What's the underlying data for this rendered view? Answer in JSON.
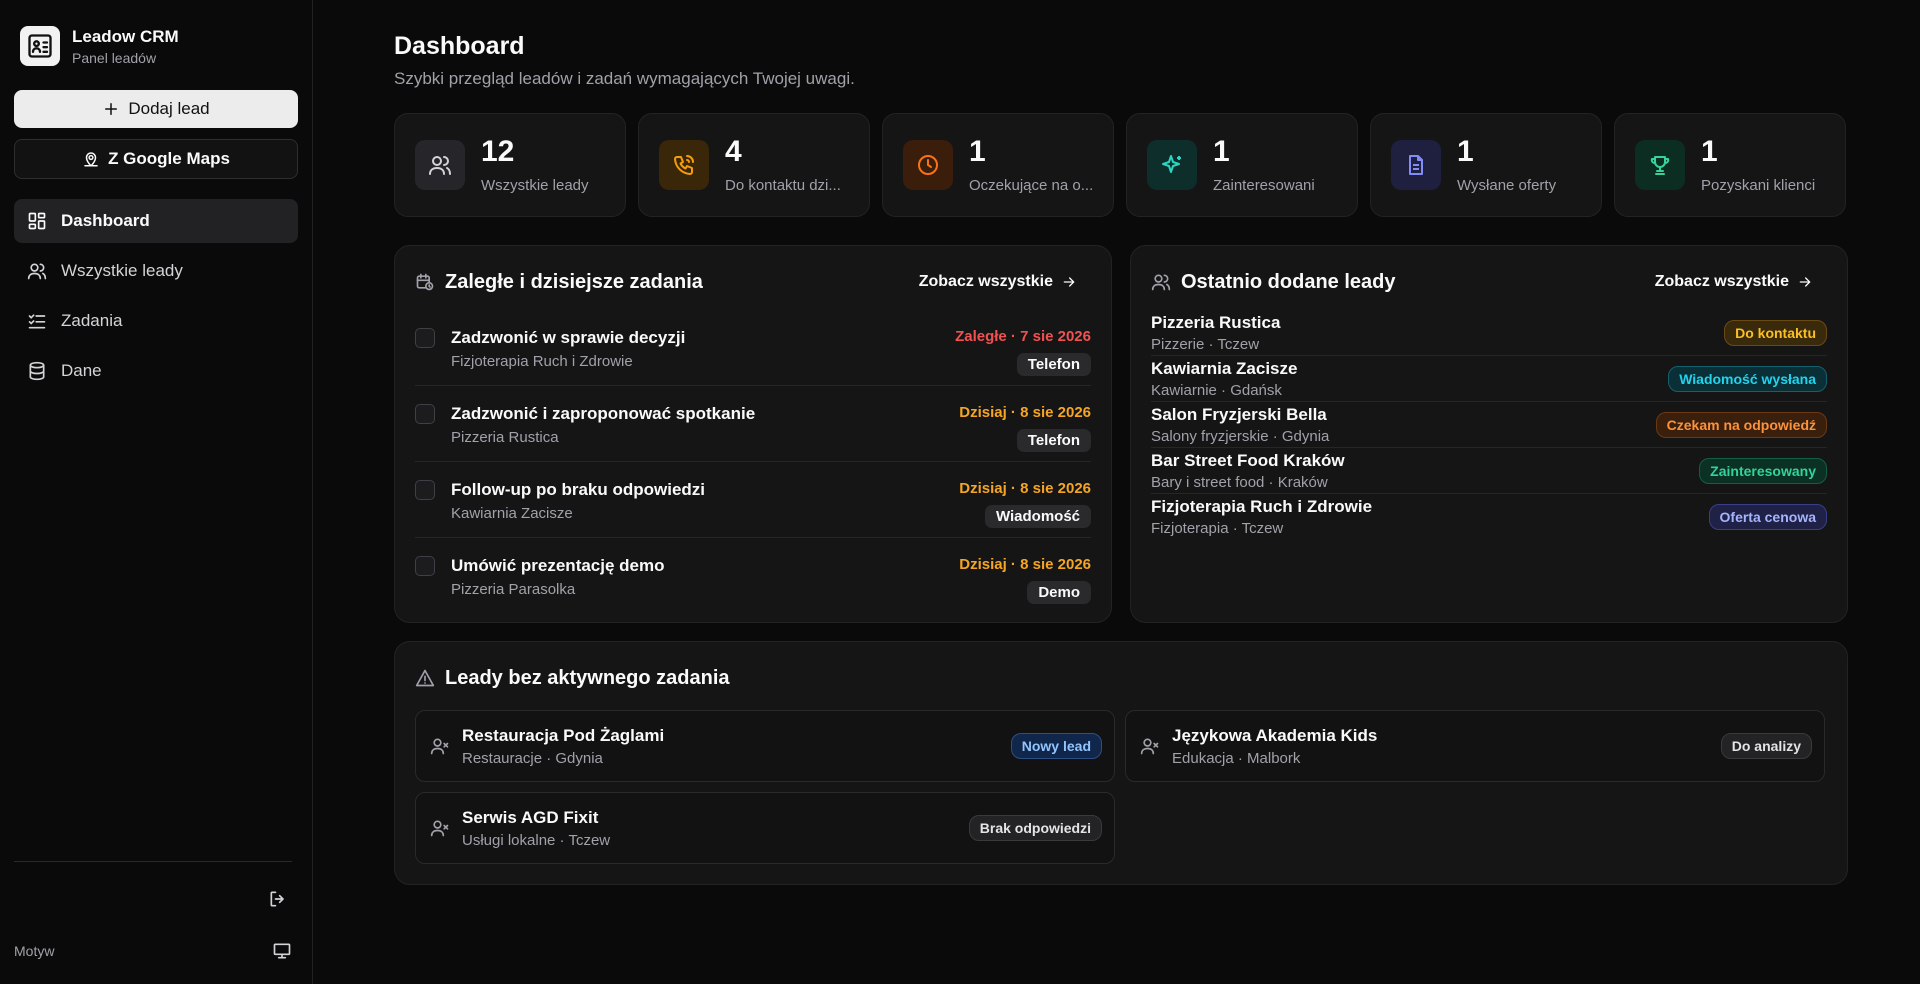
{
  "brand": {
    "title": "Leadow CRM",
    "subtitle": "Panel leadów"
  },
  "sidebar": {
    "add_lead_label": "Dodaj lead",
    "google_maps_label": "Z Google Maps",
    "items": [
      {
        "label": "Dashboard",
        "icon": "dashboard-icon",
        "active": true
      },
      {
        "label": "Wszystkie leady",
        "icon": "users-icon"
      },
      {
        "label": "Zadania",
        "icon": "checklist-icon"
      },
      {
        "label": "Dane",
        "icon": "database-icon"
      }
    ],
    "theme_label": "Motyw"
  },
  "header": {
    "title": "Dashboard",
    "subtitle": "Szybki przegląd leadów i zadań wymagających Twojej uwagi."
  },
  "stats": [
    {
      "value": "12",
      "label": "Wszystkie leady",
      "icon": "users-icon",
      "color": "#a1a1aa"
    },
    {
      "value": "4",
      "label": "Do kontaktu dzi...",
      "icon": "phone-icon",
      "color": "#f59e0b"
    },
    {
      "value": "1",
      "label": "Oczekujące na o...",
      "icon": "clock-icon",
      "color": "#f97316"
    },
    {
      "value": "1",
      "label": "Zainteresowani",
      "icon": "sparkles-icon",
      "color": "#2dd4bf"
    },
    {
      "value": "1",
      "label": "Wysłane oferty",
      "icon": "file-icon",
      "color": "#818cf8"
    },
    {
      "value": "1",
      "label": "Pozyskani klienci",
      "icon": "trophy-icon",
      "color": "#34d399"
    }
  ],
  "tasks": {
    "title": "Zaległe i dzisiejsze zadania",
    "see_all": "Zobacz wszystkie",
    "items": [
      {
        "title": "Zadzwonić w sprawie decyzji",
        "lead": "Fizjoterapia Ruch i Zdrowie",
        "due": "Zaległe · 7 sie 2026",
        "tag": "Telefon",
        "status": "over"
      },
      {
        "title": "Zadzwonić i zaproponować spotkanie",
        "lead": "Pizzeria Rustica",
        "due": "Dzisiaj · 8 sie 2026",
        "tag": "Telefon",
        "status": "today"
      },
      {
        "title": "Follow-up po braku odpowiedzi",
        "lead": "Kawiarnia Zacisze",
        "due": "Dzisiaj · 8 sie 2026",
        "tag": "Wiadomość",
        "status": "today"
      },
      {
        "title": "Umówić prezentację demo",
        "lead": "Pizzeria Parasolka",
        "due": "Dzisiaj · 8 sie 2026",
        "tag": "Demo",
        "status": "today"
      }
    ]
  },
  "recent": {
    "title": "Ostatnio dodane leady",
    "see_all": "Zobacz wszystkie",
    "items": [
      {
        "name": "Pizzeria Rustica",
        "sub": "Pizzerie · Tczew",
        "badge": "Do kontaktu",
        "color": "orange"
      },
      {
        "name": "Kawiarnia Zacisze",
        "sub": "Kawiarnie · Gdańsk",
        "badge": "Wiadomość wysłana",
        "color": "cyan"
      },
      {
        "name": "Salon Fryzjerski Bella",
        "sub": "Salony fryzjerskie · Gdynia",
        "badge": "Czekam na odpowiedź",
        "color": "amber"
      },
      {
        "name": "Bar Street Food Kraków",
        "sub": "Bary i street food · Kraków",
        "badge": "Zainteresowany",
        "color": "green"
      },
      {
        "name": "Fizjoterapia Ruch i Zdrowie",
        "sub": "Fizjoterapia · Tczew",
        "badge": "Oferta cenowa",
        "color": "indigo"
      }
    ]
  },
  "no_active": {
    "title": "Leady bez aktywnego zadania",
    "items": [
      {
        "name": "Restauracja Pod Żaglami",
        "sub": "Restauracje · Gdynia",
        "badge": "Nowy lead",
        "color": "blue"
      },
      {
        "name": "Językowa Akademia Kids",
        "sub": "Edukacja · Malbork",
        "badge": "Do analizy",
        "color": "gray"
      },
      {
        "name": "Serwis AGD Fixit",
        "sub": "Usługi lokalne · Tczew",
        "badge": "Brak odpowiedzi",
        "color": "gray"
      }
    ]
  }
}
